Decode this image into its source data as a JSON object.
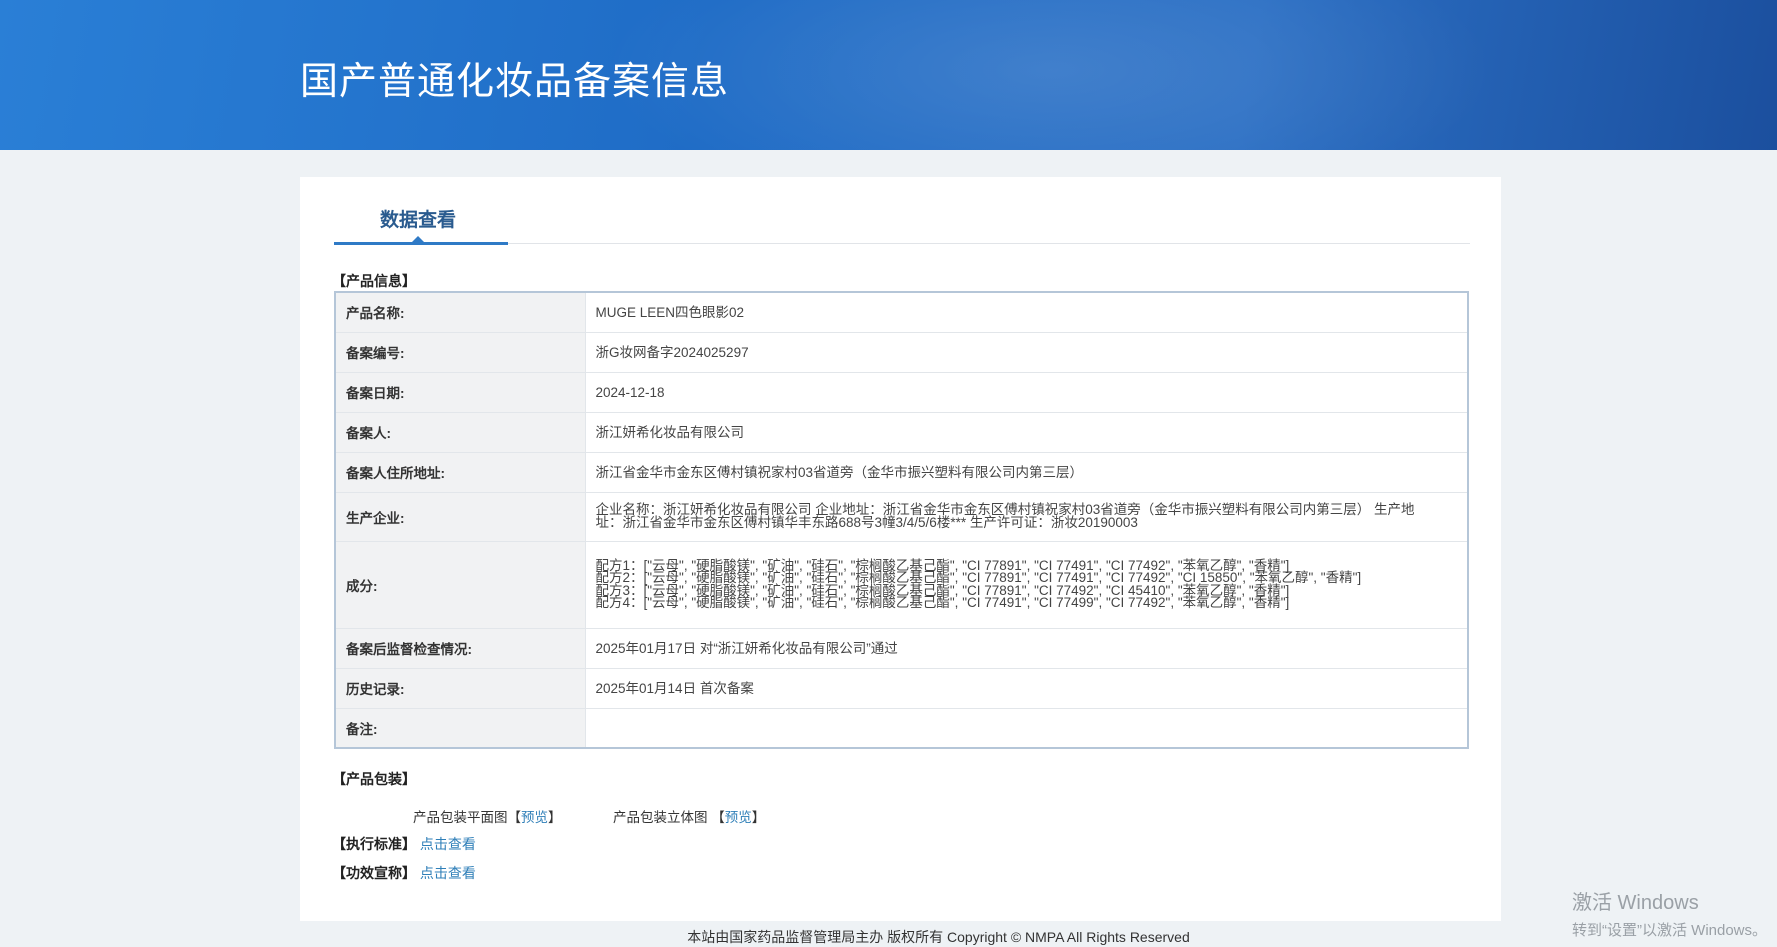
{
  "header": {
    "title": "国产普通化妆品备案信息"
  },
  "tab": {
    "label": "数据查看"
  },
  "product_info": {
    "section_label": "【产品信息】",
    "rows": [
      {
        "label": "产品名称:",
        "value": "MUGE LEEN四色眼影02"
      },
      {
        "label": "备案编号:",
        "value": "浙G妆网备字2024025297"
      },
      {
        "label": "备案日期:",
        "value": "2024-12-18"
      },
      {
        "label": "备案人:",
        "value": "浙江妍希化妆品有限公司"
      },
      {
        "label": "备案人住所地址:",
        "value": "浙江省金华市金东区傅村镇祝家村03省道旁（金华市振兴塑料有限公司内第三层）"
      },
      {
        "label": "生产企业:",
        "value": "企业名称：浙江妍希化妆品有限公司 企业地址：浙江省金华市金东区傅村镇祝家村03省道旁（金华市振兴塑料有限公司内第三层） 生产地址：浙江省金华市金东区傅村镇华丰东路688号3幢3/4/5/6楼*** 生产许可证：浙妆20190003"
      },
      {
        "label": "成分:",
        "lines": [
          "配方1：[\"云母\", \"硬脂酸镁\", \"矿油\", \"硅石\", \"棕榈酸乙基己酯\", \"CI 77891\", \"CI 77491\", \"CI 77492\", \"苯氧乙醇\", \"香精\"]",
          "配方2：[\"云母\", \"硬脂酸镁\", \"矿油\", \"硅石\", \"棕榈酸乙基己酯\", \"CI 77891\", \"CI 77491\", \"CI 77492\", \"CI 15850\", \"苯氧乙醇\", \"香精\"]",
          "配方3：[\"云母\", \"硬脂酸镁\", \"矿油\", \"硅石\", \"棕榈酸乙基己酯\", \"CI 77891\", \"CI 77492\", \"CI 45410\", \"苯氧乙醇\", \"香精\"]",
          "配方4：[\"云母\", \"硬脂酸镁\", \"矿油\", \"硅石\", \"棕榈酸乙基己酯\", \"CI 77491\", \"CI 77499\", \"CI 77492\", \"苯氧乙醇\", \"香精\"]"
        ]
      },
      {
        "label": "备案后监督检查情况:",
        "value": "2025年01月17日 对“浙江妍希化妆品有限公司”通过"
      },
      {
        "label": "历史记录:",
        "value": "2025年01月14日 首次备案"
      },
      {
        "label": "备注:",
        "value": ""
      }
    ]
  },
  "packaging": {
    "section_label": "【产品包装】",
    "flat_label": "产品包装平面图",
    "three_d_label": "产品包装立体图",
    "bracket_open": "【",
    "bracket_close": "】",
    "preview": "预览"
  },
  "standard": {
    "label": "【执行标准】",
    "link": "点击查看"
  },
  "efficacy": {
    "label": "【功效宣称】",
    "link": "点击查看"
  },
  "footer": {
    "text": "本站由国家药品监督管理局主办 版权所有 Copyright © NMPA All Rights Reserved"
  },
  "watermark": {
    "line1": "激活 Windows",
    "line2": "转到“设置”以激活 Windows。"
  }
}
